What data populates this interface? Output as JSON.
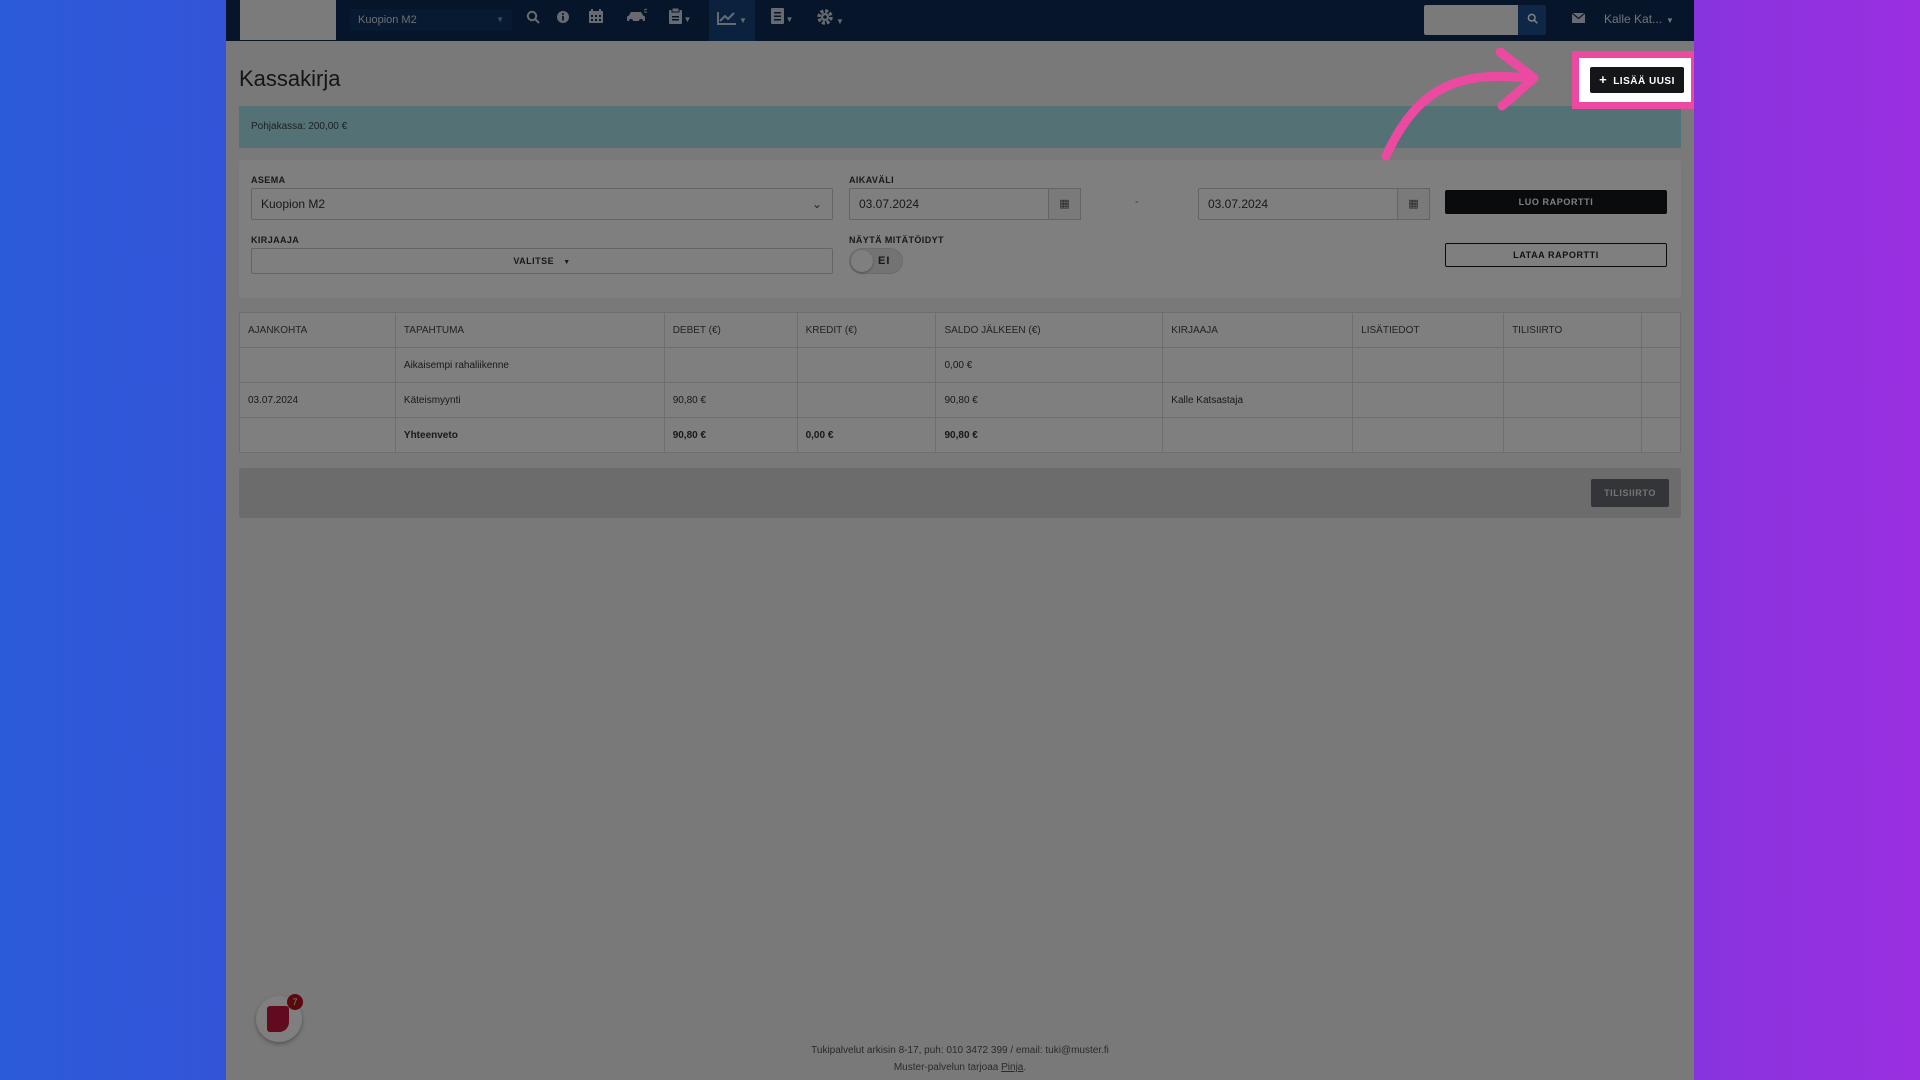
{
  "nav": {
    "station": "Kuopion M2",
    "user": "Kalle Kat...",
    "icons": [
      "search-icon",
      "info-icon",
      "calendar-icon",
      "car-icon",
      "clipboard-icon",
      "chart-icon",
      "document-icon",
      "gear-icon"
    ]
  },
  "page": {
    "title": "Kassakirja",
    "add_label": "LISÄÄ UUSI"
  },
  "banner": {
    "text": "Pohjakassa: 200,00 €"
  },
  "filters": {
    "asema_label": "ASEMA",
    "asema_value": "Kuopion M2",
    "aikavali_label": "AIKAVÄLI",
    "date_from": "03.07.2024",
    "date_to": "03.07.2024",
    "dash": "-",
    "kirjaaja_label": "KIRJAAJA",
    "kirjaaja_value": "VALITSE",
    "mitatoidyt_label": "NÄYTÄ MITÄTÖIDYT",
    "mitatoidyt_value": "EI",
    "luo_label": "LUO RAPORTTI",
    "lataa_label": "LATAA RAPORTTI"
  },
  "table": {
    "headers": [
      "AJANKOHTA",
      "TAPAHTUMA",
      "DEBET (€)",
      "KREDIT (€)",
      "SALDO JÄLKEEN (€)",
      "KIRJAAJA",
      "LISÄTIEDOT",
      "TILISIIRTO"
    ],
    "rows": [
      [
        "",
        "Aikaisempi rahaliikenne",
        "",
        "",
        "0,00 €",
        "",
        "",
        ""
      ],
      [
        "03.07.2024",
        "Käteismyynti",
        "90,80 €",
        "",
        "90,80 €",
        "Kalle Katsastaja",
        "",
        ""
      ]
    ],
    "total": [
      "",
      "Yhteenveto",
      "90,80 €",
      "0,00 €",
      "90,80 €",
      "",
      "",
      ""
    ]
  },
  "bottom": {
    "tilisiirto_label": "TILISIIRTO"
  },
  "footer": {
    "line1": "Tukipalvelut arkisin 8-17, puh: 010 3472 399 / email: tuki@muster.fi",
    "line2_prefix": "Muster-palvelun tarjoaa ",
    "line2_link": "Pinja",
    "line2_suffix": "."
  },
  "chat": {
    "badge": "7"
  },
  "colors": {
    "nav": "#0c2a52",
    "highlight": "#ec4aa1",
    "banner": "#a9e3ea"
  }
}
